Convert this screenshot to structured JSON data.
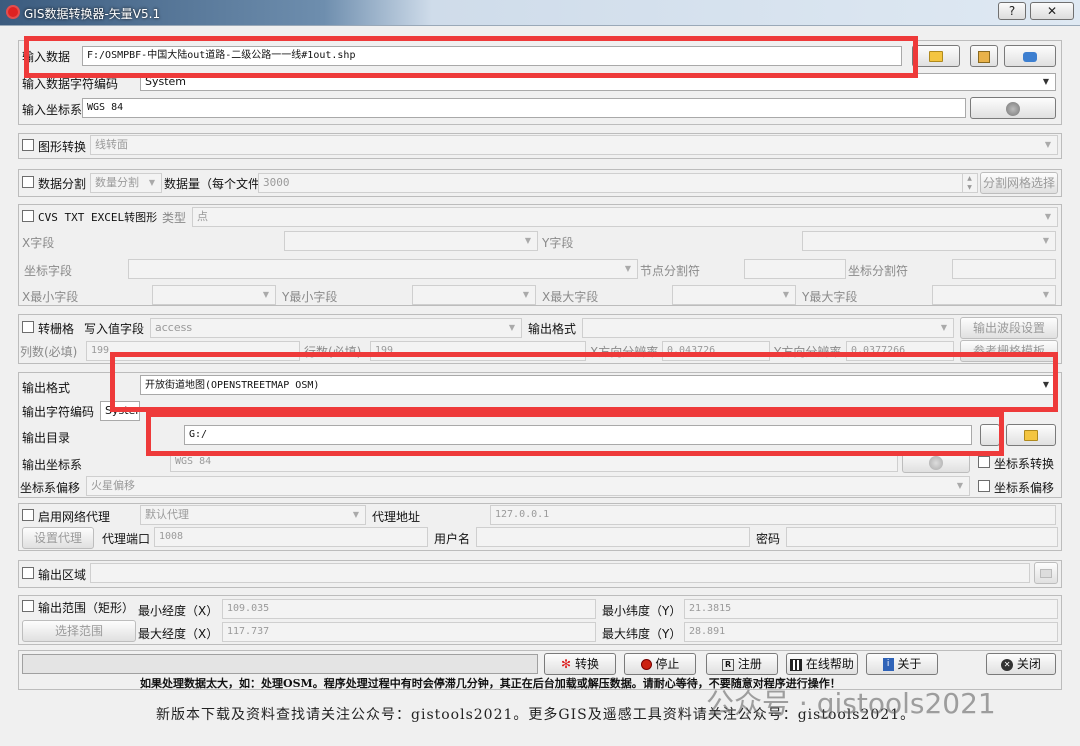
{
  "window": {
    "title": "GIS数据转换器-矢量V5.1",
    "help_btn": "?",
    "close_btn": "✕"
  },
  "input": {
    "data_label": "输入数据",
    "data_value": "F:/OSMPBF-中国大陆out道路-二级公路一一线#1out.shp",
    "charset_label": "输入数据字符编码",
    "charset_value": "System",
    "crs_label": "输入坐标系",
    "crs_value": "WGS 84"
  },
  "shape_convert": {
    "label": "图形转换",
    "value": "线转面"
  },
  "split": {
    "label": "数据分割",
    "mode": "数量分割",
    "count_label": "数据量（每个文件",
    "count_value": "3000",
    "grid_btn": "分割网格选择"
  },
  "csv": {
    "label": "CVS TXT EXCEL转图形",
    "type_label": "类型",
    "type_value": "点",
    "x_field": "X字段",
    "y_field": "Y字段",
    "coord_field": "坐标字段",
    "node_sep": "节点分割符",
    "coord_sep": "坐标分割符",
    "xmin_field": "X最小字段",
    "ymin_field": "Y最小字段",
    "xmax_field": "X最大字段",
    "ymax_field": "Y最大字段"
  },
  "raster": {
    "label": "转栅格",
    "write_field_label": "写入值字段",
    "write_field_value": "access",
    "out_format_label": "输出格式",
    "band_btn": "输出波段设置",
    "cols_label": "列数(必填)",
    "cols_value": "199",
    "rows_label": "行数(必填)",
    "rows_value": "199",
    "xres_label": "X方向分辨率",
    "xres_value": "0.043726",
    "yres_label": "Y方向分辨率",
    "yres_value": "0.0377266",
    "ref_btn": "参考栅格模板"
  },
  "output": {
    "format_label": "输出格式",
    "format_value": "开放街道地图(OPENSTREETMAP OSM)",
    "charset_label": "输出字符编码",
    "charset_value": "System",
    "dir_label": "输出目录",
    "dir_value": "G:/",
    "crs_label": "输出坐标系",
    "crs_value": "WGS 84",
    "crs_convert": "坐标系转换",
    "offset_label": "坐标系偏移",
    "offset_value": "火星偏移",
    "offset_check": "坐标系偏移"
  },
  "proxy": {
    "label": "启用网络代理",
    "mode": "默认代理",
    "addr_label": "代理地址",
    "addr_value": "127.0.0.1",
    "set_btn": "设置代理",
    "port_label": "代理端口",
    "port_value": "1008",
    "user_label": "用户名",
    "pwd_label": "密码"
  },
  "region": {
    "label": "输出区域"
  },
  "extent": {
    "label": "输出范围（矩形）",
    "min_lon_label": "最小经度（X）",
    "min_lon": "109.035",
    "min_lat_label": "最小纬度（Y）",
    "min_lat": "21.3815",
    "max_lon_label": "最大经度（X）",
    "max_lon": "117.737",
    "max_lat_label": "最大纬度（Y）",
    "max_lat": "28.891",
    "select_btn": "选择范围"
  },
  "actions": {
    "convert": "转换",
    "stop": "停止",
    "register": "注册",
    "help": "在线帮助",
    "about": "关于",
    "close": "关闭"
  },
  "note": "如果处理数据太大，如：处理OSM。程序处理过程中有时会停滞几分钟，其正在后台加载或解压数据。请耐心等待，不要随意对程序进行操作！",
  "footer": "新版本下载及资料查找请关注公众号：gistools2021。更多GIS及遥感工具资料请关注公众号：gistools2021。",
  "watermark": "公众号 · gistools2021",
  "accent": {
    "highlight": "#ee3a3a",
    "folder": "#f4c540"
  }
}
